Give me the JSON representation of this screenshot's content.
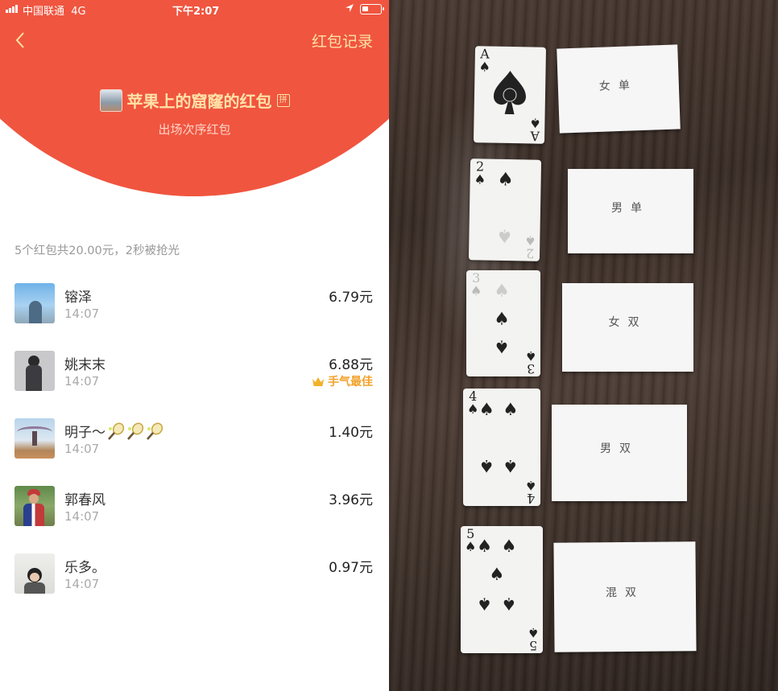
{
  "status_bar": {
    "carrier": "中国联通",
    "network": "4G",
    "time": "下午2:07"
  },
  "nav": {
    "back_icon": "back-chevron-icon",
    "records_link": "红包记录"
  },
  "packet": {
    "title": "苹果上的窟窿的红包",
    "pin_badge": "拼",
    "subtitle": "出场次序红包"
  },
  "summary": "5个红包共20.00元，2秒被抢光",
  "recipients": [
    {
      "name": "镕泽",
      "time": "14:07",
      "amount": "6.79元"
    },
    {
      "name": "姚末末",
      "time": "14:07",
      "amount": "6.88元",
      "badge": "手气最佳"
    },
    {
      "name": "明子～",
      "time": "14:07",
      "amount": "1.40元"
    },
    {
      "name": "郭春风",
      "time": "14:07",
      "amount": "3.96元"
    },
    {
      "name": "乐多。",
      "time": "14:07",
      "amount": "0.97元"
    }
  ],
  "colors": {
    "header_red": "#f0553f",
    "gold": "#ffe2a8",
    "best_orange": "#f2a22a"
  },
  "photo": {
    "cards": [
      {
        "rank": "A",
        "suit": "spade",
        "note": "女单"
      },
      {
        "rank": "2",
        "suit": "spade",
        "note": "男单"
      },
      {
        "rank": "3",
        "suit": "spade",
        "note": "女双"
      },
      {
        "rank": "4",
        "suit": "spade",
        "note": "男双"
      },
      {
        "rank": "5",
        "suit": "spade",
        "note": "混双"
      }
    ]
  }
}
